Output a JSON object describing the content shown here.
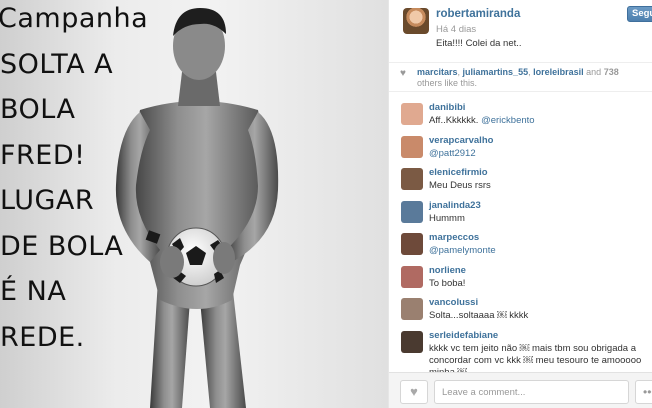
{
  "photo": {
    "caption_lines": [
      "Campanha",
      "SOLTA A",
      "BOLA",
      "FRED!",
      "LUGAR",
      "DE BOLA",
      "É NA",
      "REDE."
    ]
  },
  "post": {
    "owner": "robertamiranda",
    "time": "Há 4 dias",
    "caption": "Eita!!!! Colei da net..",
    "follow_label": "Segui"
  },
  "likes": {
    "users": [
      "marcitars",
      "juliamartins_55",
      "loreleibrasil"
    ],
    "and_text": "and",
    "count": "738",
    "others_text": "others like this."
  },
  "comments": [
    {
      "user": "danibibi",
      "text": "Aff..Kkkkkk.",
      "mention": "@erickbento",
      "avatar": "#e0a990"
    },
    {
      "user": "verapcarvalho",
      "text": "",
      "mention": "@patt2912",
      "avatar": "#c98a6a"
    },
    {
      "user": "elenicefirmio",
      "text": "Meu Deus rsrs",
      "mention": "",
      "avatar": "#7b5a44"
    },
    {
      "user": "janalinda23",
      "text": "Hummm",
      "mention": "",
      "avatar": "#5a7a9a"
    },
    {
      "user": "marpeccos",
      "text": "",
      "mention": "@pamelymonte",
      "avatar": "#6e4a3a"
    },
    {
      "user": "norliene",
      "text": "To boba!",
      "mention": "",
      "avatar": "#b06a62"
    },
    {
      "user": "vancolussi",
      "text": "Solta...soltaaaa ￼ kkkk",
      "mention": "",
      "avatar": "#9a8070"
    },
    {
      "user": "serleidefabiane",
      "text": "kkkk vc tem jeito não ￼ mais tbm sou obrigada a concordar com vc kkk ￼ meu tesouro te amooooo minha ￼",
      "mention": "",
      "avatar": "#4a3a30"
    }
  ],
  "footer": {
    "comment_placeholder": "Leave a comment...",
    "like_icon": "heart-icon",
    "more_label": "•••"
  },
  "colors": {
    "link": "#3f729b",
    "follow_button": "#4d7fae"
  }
}
